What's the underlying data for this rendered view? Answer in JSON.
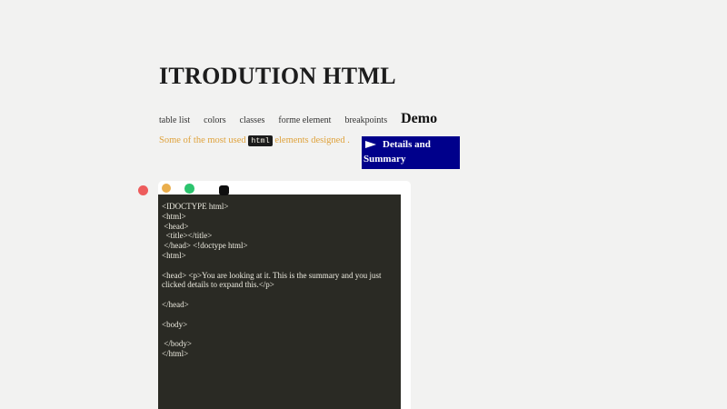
{
  "header": {
    "title": "ITRODUTION HTML"
  },
  "nav": {
    "items": [
      "table list",
      "colors",
      "classes",
      "forme element",
      "breakpoints"
    ],
    "demo_label": "Demo"
  },
  "intro": {
    "before_code": "Some of the most used",
    "code_word": "html",
    "after_code": "elements designed ."
  },
  "details_widget": {
    "summary": "Details and Summary",
    "marker_icon": "triangle-right"
  },
  "editor_window": {
    "traffic_lights": [
      "red",
      "orange",
      "green",
      "black-square"
    ],
    "code_lines": [
      "<IDOCTYPE html>",
      "<html>",
      " <head>",
      "  <title></title>",
      " </head> <!doctype html>",
      "<html>",
      "",
      "<head> <p>You are looking at it. This is the summary and you just",
      "clicked details to expand this.</p>",
      "",
      "</head>",
      "",
      "<body>",
      "",
      " </body>",
      "</html>"
    ]
  },
  "colors": {
    "page_bg": "#f2f2f1",
    "title_text": "#1d1d1d",
    "nav_text": "#333333",
    "accent_text": "#dfa23c",
    "badge_bg": "#1b1b1b",
    "badge_text": "#f2efe4",
    "details_bg": "#00008b",
    "details_text": "#ffffff",
    "window_bg": "#ffffff",
    "code_bg": "#2a2a24",
    "code_text": "#edebe0",
    "dot_red": "#ed5c5c",
    "dot_orange": "#eaae4c",
    "dot_green": "#2cc46e",
    "dot_black": "#0f0f0f"
  }
}
